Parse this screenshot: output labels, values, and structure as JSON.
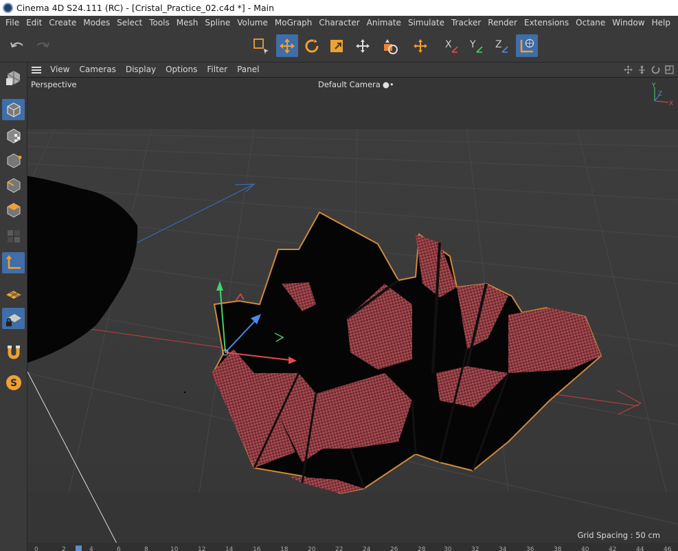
{
  "window": {
    "title": "Cinema 4D S24.111 (RC) - [Cristal_Practice_02.c4d *] - Main"
  },
  "menu": [
    "File",
    "Edit",
    "Create",
    "Modes",
    "Select",
    "Tools",
    "Mesh",
    "Spline",
    "Volume",
    "MoGraph",
    "Character",
    "Animate",
    "Simulate",
    "Tracker",
    "Render",
    "Extensions",
    "Octane",
    "Window",
    "Help"
  ],
  "toolbar": {
    "undo_icon": "undo-icon",
    "redo_icon": "redo-icon",
    "axis_x": "X",
    "axis_y": "Y",
    "axis_z": "Z"
  },
  "viewport_menu": [
    "View",
    "Cameras",
    "Display",
    "Options",
    "Filter",
    "Panel"
  ],
  "viewport": {
    "projection": "Perspective",
    "camera": "Default Camera",
    "grid_spacing": "Grid Spacing : 50 cm",
    "gizmo_y": "Y",
    "gizmo_z": "Z",
    "gizmo_x": "X"
  },
  "timeline": {
    "ticks": [
      "0",
      "2",
      "4",
      "6",
      "8",
      "10",
      "12",
      "14",
      "16",
      "18",
      "20",
      "22",
      "24",
      "26",
      "28",
      "30",
      "32",
      "34",
      "36",
      "38",
      "40",
      "42",
      "44",
      "46"
    ]
  },
  "colors": {
    "accent": "#3f6ea8",
    "selection_outline": "#d08a3a",
    "crystal": "#b4545a",
    "axis_x": "#e84a4a",
    "axis_y": "#4ad06a",
    "axis_z": "#4a8ae8"
  }
}
